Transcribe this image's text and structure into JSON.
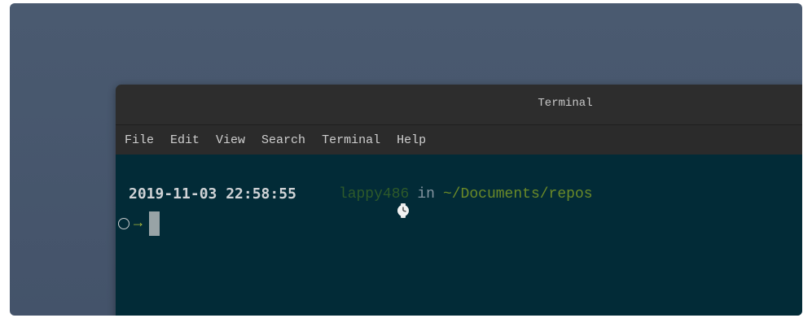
{
  "window": {
    "title": "Terminal"
  },
  "menu": {
    "items": [
      "File",
      "Edit",
      "View",
      "Search",
      "Terminal",
      "Help"
    ]
  },
  "prompt": {
    "timestamp": "2019-11-03 22:58:55",
    "clock_icon": "clock-icon",
    "host": "lappy486",
    "in_label": "in",
    "path": "~/Documents/repos",
    "status_icon": "circle-icon",
    "arrow": "→"
  },
  "colors": {
    "terminal_bg": "#022b37",
    "host": "#2e5a2a",
    "path": "#6b8a28",
    "arrow": "#a8b83a",
    "desktop": "#4a5a70"
  }
}
